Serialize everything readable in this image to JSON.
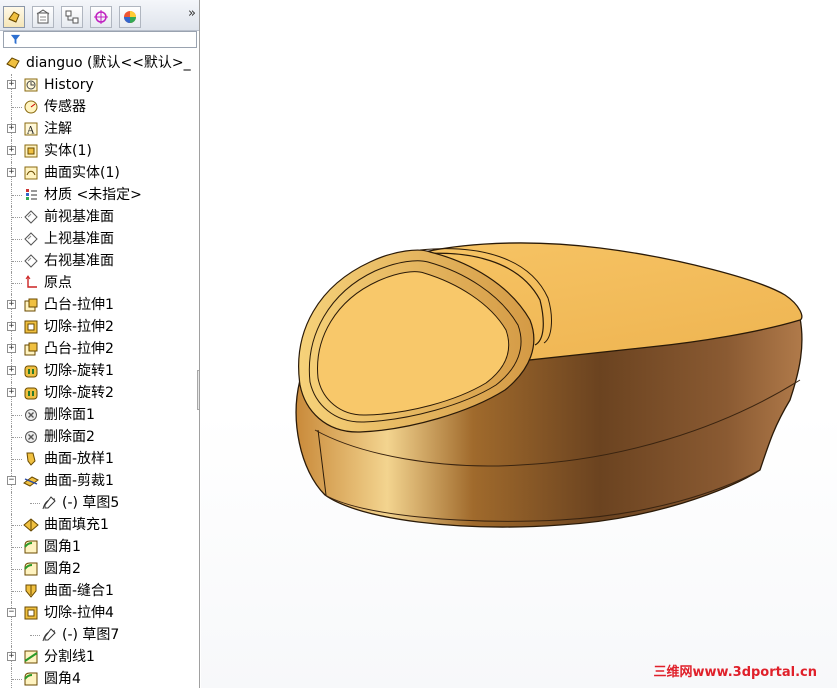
{
  "tabs": [
    {
      "name": "featuremanager-tab",
      "icon": "featuremanager-icon"
    },
    {
      "name": "propertymanager-tab",
      "icon": "propertymanager-icon"
    },
    {
      "name": "configurationmanager-tab",
      "icon": "configurationmanager-icon"
    },
    {
      "name": "dimxpert-tab",
      "icon": "dimxpert-icon"
    },
    {
      "name": "display-manager-tab",
      "icon": "display-manager-icon"
    }
  ],
  "more_label": "»",
  "root": {
    "label": "dianguo  (默认<<默认>_"
  },
  "tree": [
    {
      "label": "History",
      "icon": "history-icon",
      "expander": true
    },
    {
      "label": "传感器",
      "icon": "sensor-icon",
      "expander": false
    },
    {
      "label": "注解",
      "icon": "annotation-icon",
      "expander": true
    },
    {
      "label": "实体(1)",
      "icon": "solid-bodies-icon",
      "expander": true
    },
    {
      "label": "曲面实体(1)",
      "icon": "surface-bodies-icon",
      "expander": true
    },
    {
      "label": "材质 <未指定>",
      "icon": "material-icon",
      "expander": false
    },
    {
      "label": "前视基准面",
      "icon": "plane-icon",
      "expander": false
    },
    {
      "label": "上视基准面",
      "icon": "plane-icon",
      "expander": false
    },
    {
      "label": "右视基准面",
      "icon": "plane-icon",
      "expander": false
    },
    {
      "label": "原点",
      "icon": "origin-icon",
      "expander": false
    },
    {
      "label": "凸台-拉伸1",
      "icon": "boss-extrude-icon",
      "expander": true
    },
    {
      "label": "切除-拉伸2",
      "icon": "cut-extrude-icon",
      "expander": true
    },
    {
      "label": "凸台-拉伸2",
      "icon": "boss-extrude-icon",
      "expander": true
    },
    {
      "label": "切除-旋转1",
      "icon": "cut-revolve-icon",
      "expander": true
    },
    {
      "label": "切除-旋转2",
      "icon": "cut-revolve-icon",
      "expander": true
    },
    {
      "label": "删除面1",
      "icon": "delete-face-icon",
      "expander": false
    },
    {
      "label": "删除面2",
      "icon": "delete-face-icon",
      "expander": false
    },
    {
      "label": "曲面-放样1",
      "icon": "surface-loft-icon",
      "expander": false
    },
    {
      "label": "曲面-剪裁1",
      "icon": "surface-trim-icon",
      "expander": "open"
    },
    {
      "label": "(-) 草图5",
      "icon": "sketch-icon",
      "expander": false,
      "child": true
    },
    {
      "label": "曲面填充1",
      "icon": "surface-fill-icon",
      "expander": false
    },
    {
      "label": "圆角1",
      "icon": "fillet-icon",
      "expander": false
    },
    {
      "label": "圆角2",
      "icon": "fillet-icon",
      "expander": false
    },
    {
      "label": "曲面-缝合1",
      "icon": "surface-knit-icon",
      "expander": false
    },
    {
      "label": "切除-拉伸4",
      "icon": "cut-extrude-icon",
      "expander": "open"
    },
    {
      "label": "(-) 草图7",
      "icon": "sketch-icon",
      "expander": false,
      "child": true
    },
    {
      "label": "分割线1",
      "icon": "split-line-icon",
      "expander": true
    },
    {
      "label": "圆角4",
      "icon": "fillet-icon",
      "expander": false
    }
  ],
  "watermark": "三维网www.3dportal.cn",
  "colors": {
    "model_light": "#f7c566",
    "model_mid": "#e8a94a",
    "model_dark": "#6b4320",
    "edge": "#2a1a08"
  }
}
